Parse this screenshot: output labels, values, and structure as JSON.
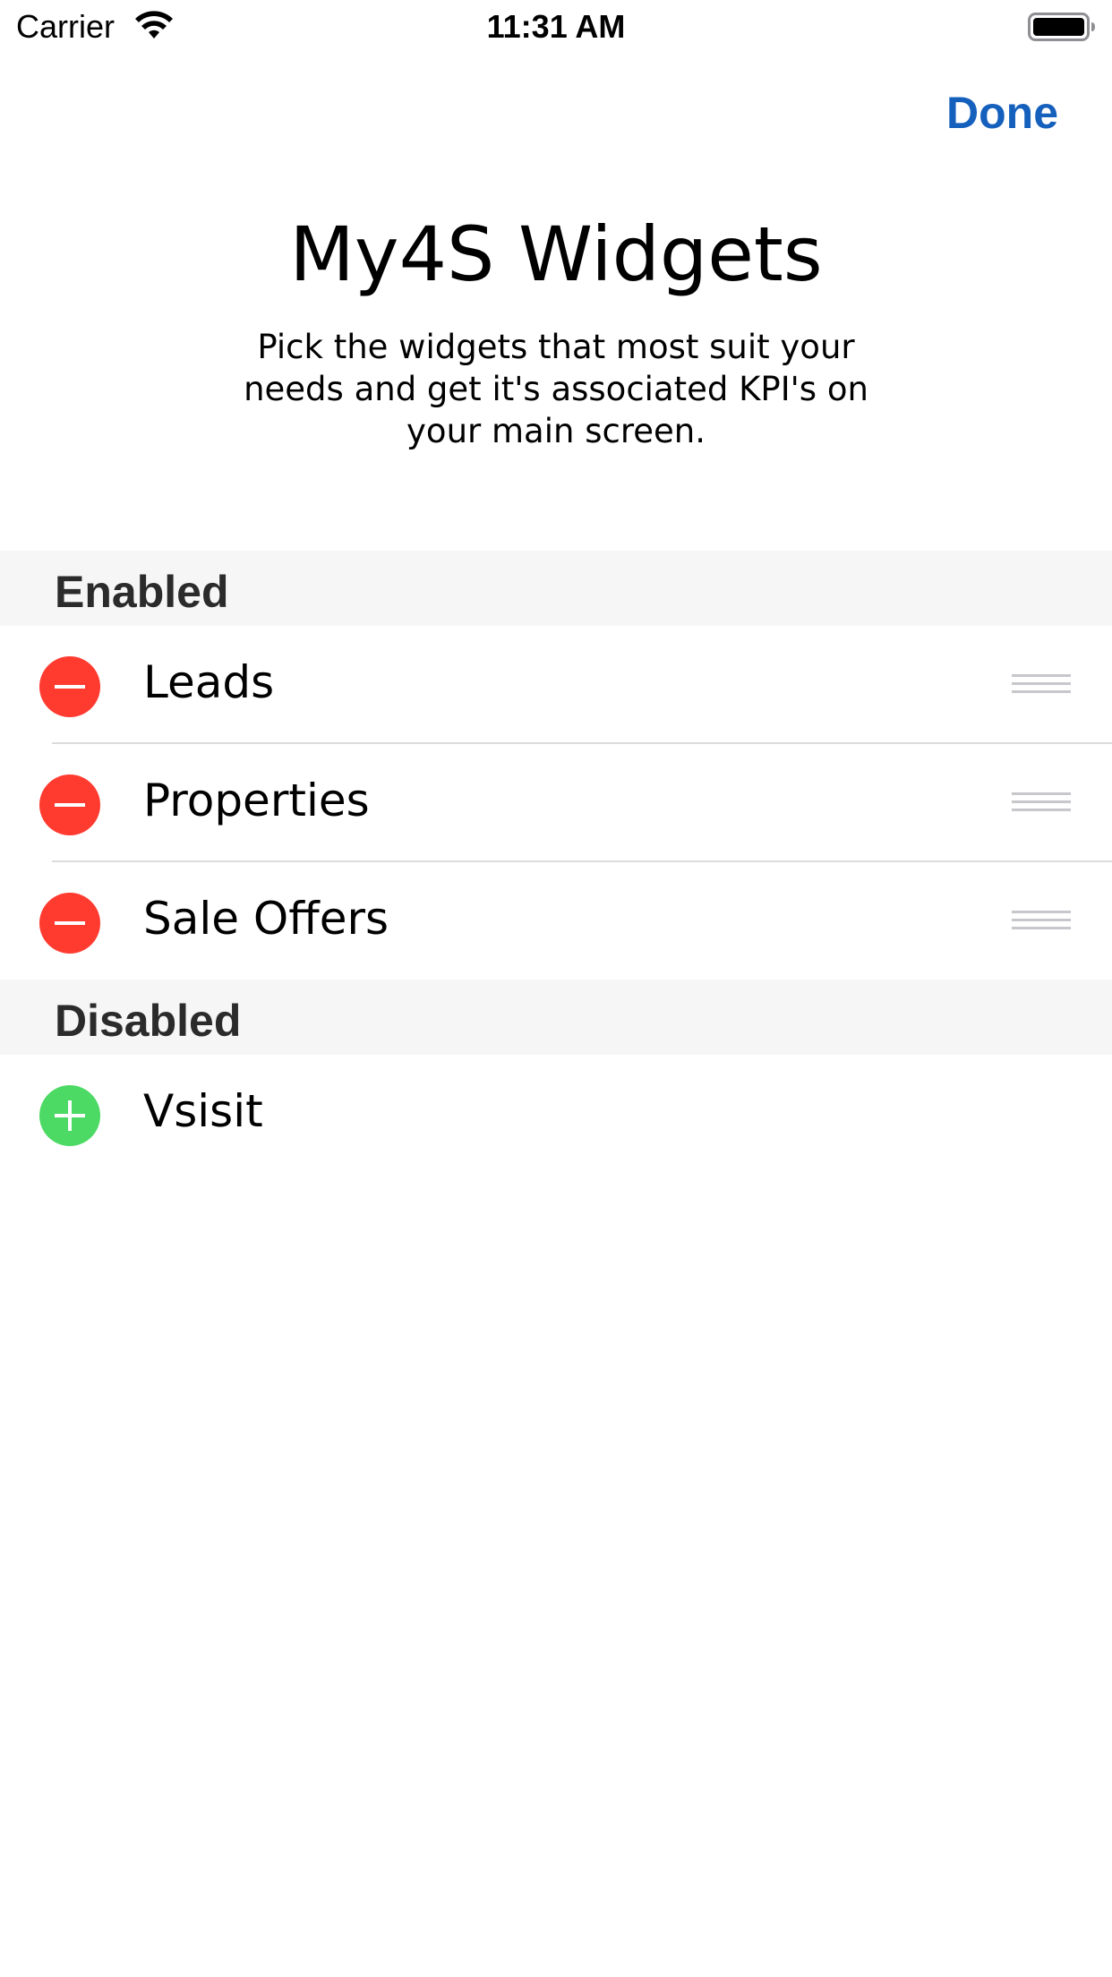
{
  "status_bar": {
    "carrier": "Carrier",
    "time": "11:31 AM",
    "wifi_icon": "wifi-icon",
    "battery_icon": "battery-icon"
  },
  "nav": {
    "done_label": "Done"
  },
  "header": {
    "title": "My4S Widgets",
    "subtitle": "Pick the widgets that most suit your needs and get it's associated KPI's on your main screen."
  },
  "sections": {
    "enabled": {
      "label": "Enabled",
      "items": [
        {
          "label": "Leads",
          "action_icon": "minus-icon",
          "action": "remove"
        },
        {
          "label": "Properties",
          "action_icon": "minus-icon",
          "action": "remove"
        },
        {
          "label": "Sale Offers",
          "action_icon": "minus-icon",
          "action": "remove"
        }
      ]
    },
    "disabled": {
      "label": "Disabled",
      "items": [
        {
          "label": "Vsisit",
          "action_icon": "plus-icon",
          "action": "add"
        }
      ]
    }
  },
  "colors": {
    "accent": "#1560bd",
    "delete": "#ff3b30",
    "insert": "#4cd964",
    "section_bg": "#f6f6f6",
    "separator": "#dcdcdc"
  }
}
